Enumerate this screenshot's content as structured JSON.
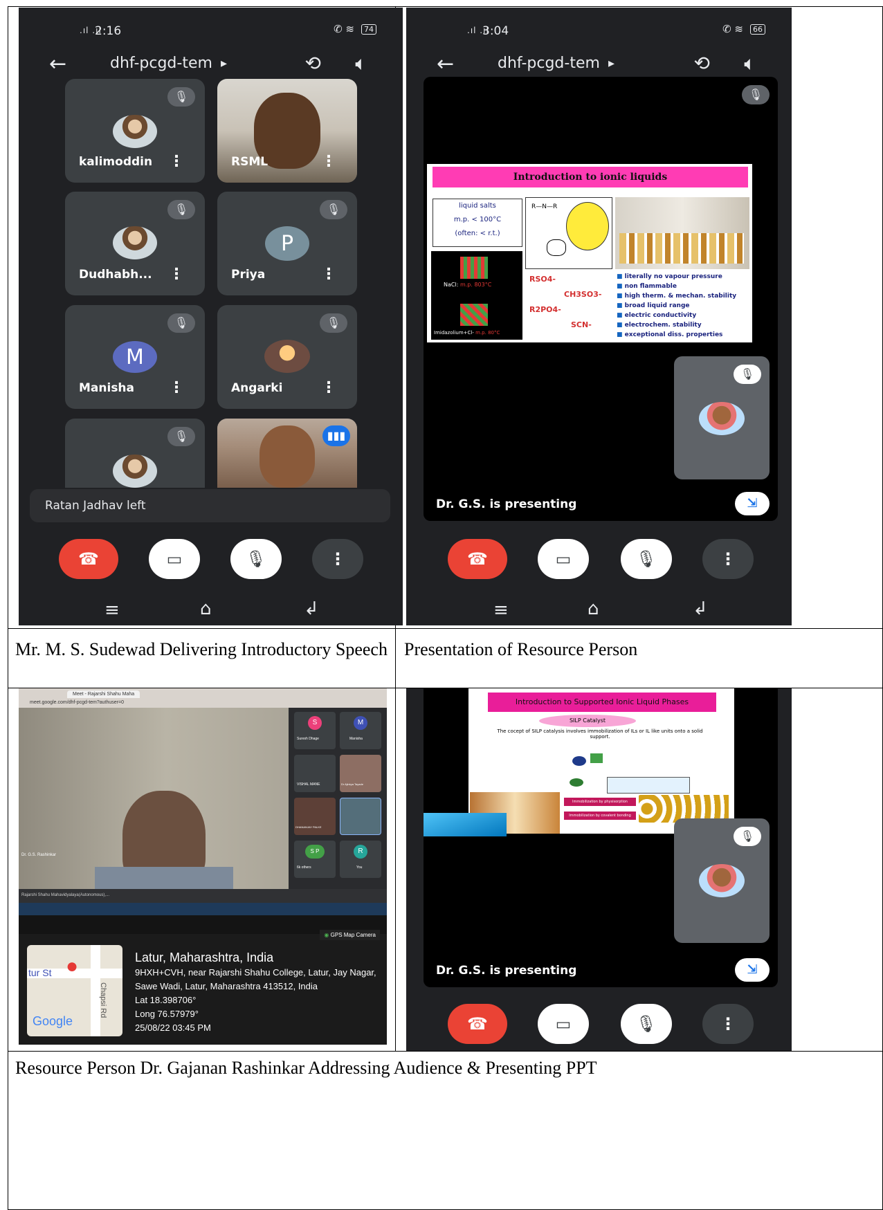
{
  "captions": {
    "top_left": "Mr. M. S. Sudewad  Delivering  Introductory Speech",
    "top_right": "Presentation of Resource Person",
    "bottom": "Resource Person Dr. Gajanan Rashinkar Addressing Audience & Presenting PPT"
  },
  "screen1": {
    "time": "2:16",
    "battery": "74",
    "meeting_code": "dhf-pcgd-tem",
    "participants": [
      "kalimoddin",
      "RSML",
      "Dudhabh...",
      "Priya",
      "Manisha",
      "Angarki"
    ],
    "avatar_letters": {
      "priya": "P",
      "manisha": "M"
    },
    "notice": "Ratan Jadhav left"
  },
  "screen2": {
    "time": "3:04",
    "battery": "66",
    "meeting_code": "dhf-pcgd-tem",
    "slide_title": "Introduction to ionic liquids",
    "slide_box": [
      "liquid salts",
      "m.p. < 100°C",
      "(often: < r.t.)"
    ],
    "slide_anions": [
      "RSO4-",
      "CH3SO3-",
      "R2PO4-",
      "SCN-"
    ],
    "slide_nacl": "NaCl:",
    "slide_nacl_mp": "m.p. 803°C",
    "slide_imid": "Imidazolium+Cl-",
    "slide_imid_mp": "m.p. 80°C",
    "slide_bullets": [
      "literally no vapour pressure",
      "non flammable",
      "high therm. & mechan. stability",
      "broad liquid range",
      "electric conductivity",
      "electrochem. stability",
      "exceptional diss. properties"
    ],
    "presenting": "Dr. G.S. is presenting"
  },
  "screen3": {
    "gps_camera": "GPS Map Camera",
    "city": "Latur, Maharashtra, India",
    "address": "9HXH+CVH, near Rajarshi Shahu College, Latur, Jay Nagar, Sawe Wadi, Latur, Maharashtra 413512, India",
    "lat": "Lat 18.398706°",
    "long": "Long 76.57979°",
    "datetime": "25/08/22 03:45 PM",
    "map_street": "tur St",
    "map_road": "Chapsi Rd",
    "map_logo": "Google",
    "tiles": [
      "Suresh Dhage",
      "Manisha",
      "VISHAL MANE",
      "Dr Ajinkya Tayade",
      "DHANANJAY PALKE",
      "6k others",
      "You"
    ],
    "tile_letters": [
      "S",
      "M",
      "S P",
      "R"
    ],
    "tab_label": "Meet - Rajarshi Shahu Maha",
    "url": "meet.google.com/dhf-pcgd-tem?authuser=0",
    "taskbar_text": "Rajarshi Shahu Mahavidyalaya(Autonomous),...",
    "presenter_tag": "Dr. G.S. Rashinkar"
  },
  "screen4": {
    "slide_title": "Introduction to Supported Ionic Liquid Phases",
    "silp_label": "SILP Catalyst",
    "silp_text": "The cocept of SILP catalysis involves immobilization of ILs or IL like units onto a solid support.",
    "arrow1": "Immobilization by physisorption",
    "arrow2": "Immobilization by covalent bonding",
    "presenting": "Dr. G.S. is presenting"
  },
  "colors": {
    "meet_bg": "#202124",
    "end_call": "#ea4335",
    "slide_pink": "#ff3cb4"
  }
}
